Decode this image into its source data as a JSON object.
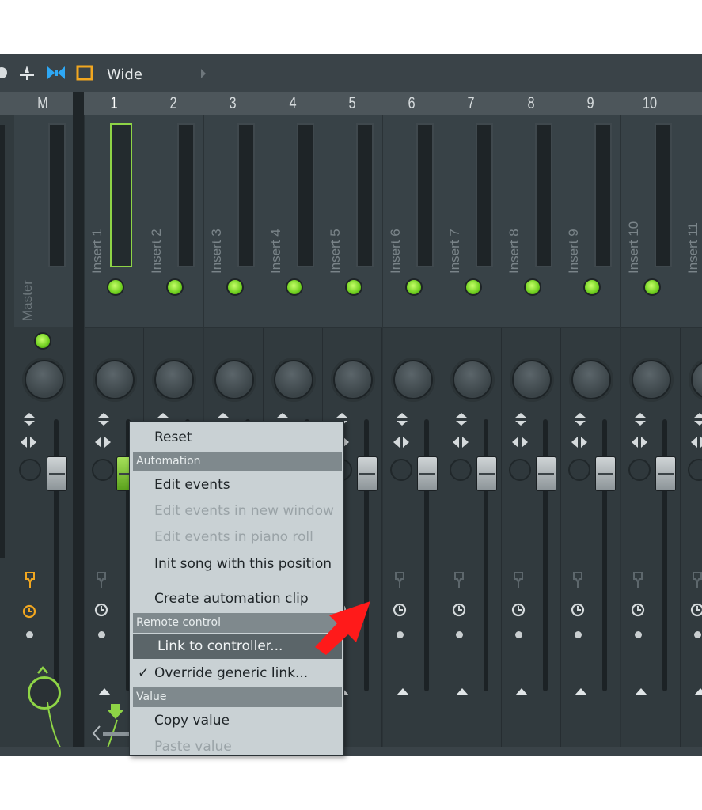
{
  "toolbar": {
    "view_label": "Wide"
  },
  "colors": {
    "accent_green": "#8ed446",
    "master_orange": "#f2a720",
    "menu_bg": "#c9d1d4",
    "menu_highlight": "#5b6569",
    "arrow_red": "#ff1a1a"
  },
  "header": {
    "master": "M",
    "channels": [
      "1",
      "2",
      "3",
      "4",
      "5",
      "6",
      "7",
      "8",
      "9",
      "10"
    ]
  },
  "strips": {
    "master": "Master",
    "names": [
      "Insert 1",
      "Insert 2",
      "Insert 3",
      "Insert 4",
      "Insert 5",
      "Insert 6",
      "Insert 7",
      "Insert 8",
      "Insert 9",
      "Insert 10",
      "Insert 11"
    ]
  },
  "menu": {
    "reset": "Reset",
    "h_automation": "Automation",
    "edit_events": "Edit events",
    "edit_events_new_window": "Edit events in new window",
    "edit_events_piano_roll": "Edit events in piano roll",
    "init_song": "Init song with this position",
    "create_clip": "Create automation clip",
    "h_remote": "Remote control",
    "link_controller": "Link to controller...",
    "check_mark": "✓",
    "override_link": "Override generic link...",
    "h_value": "Value",
    "copy_value": "Copy value",
    "paste_value": "Paste value"
  }
}
